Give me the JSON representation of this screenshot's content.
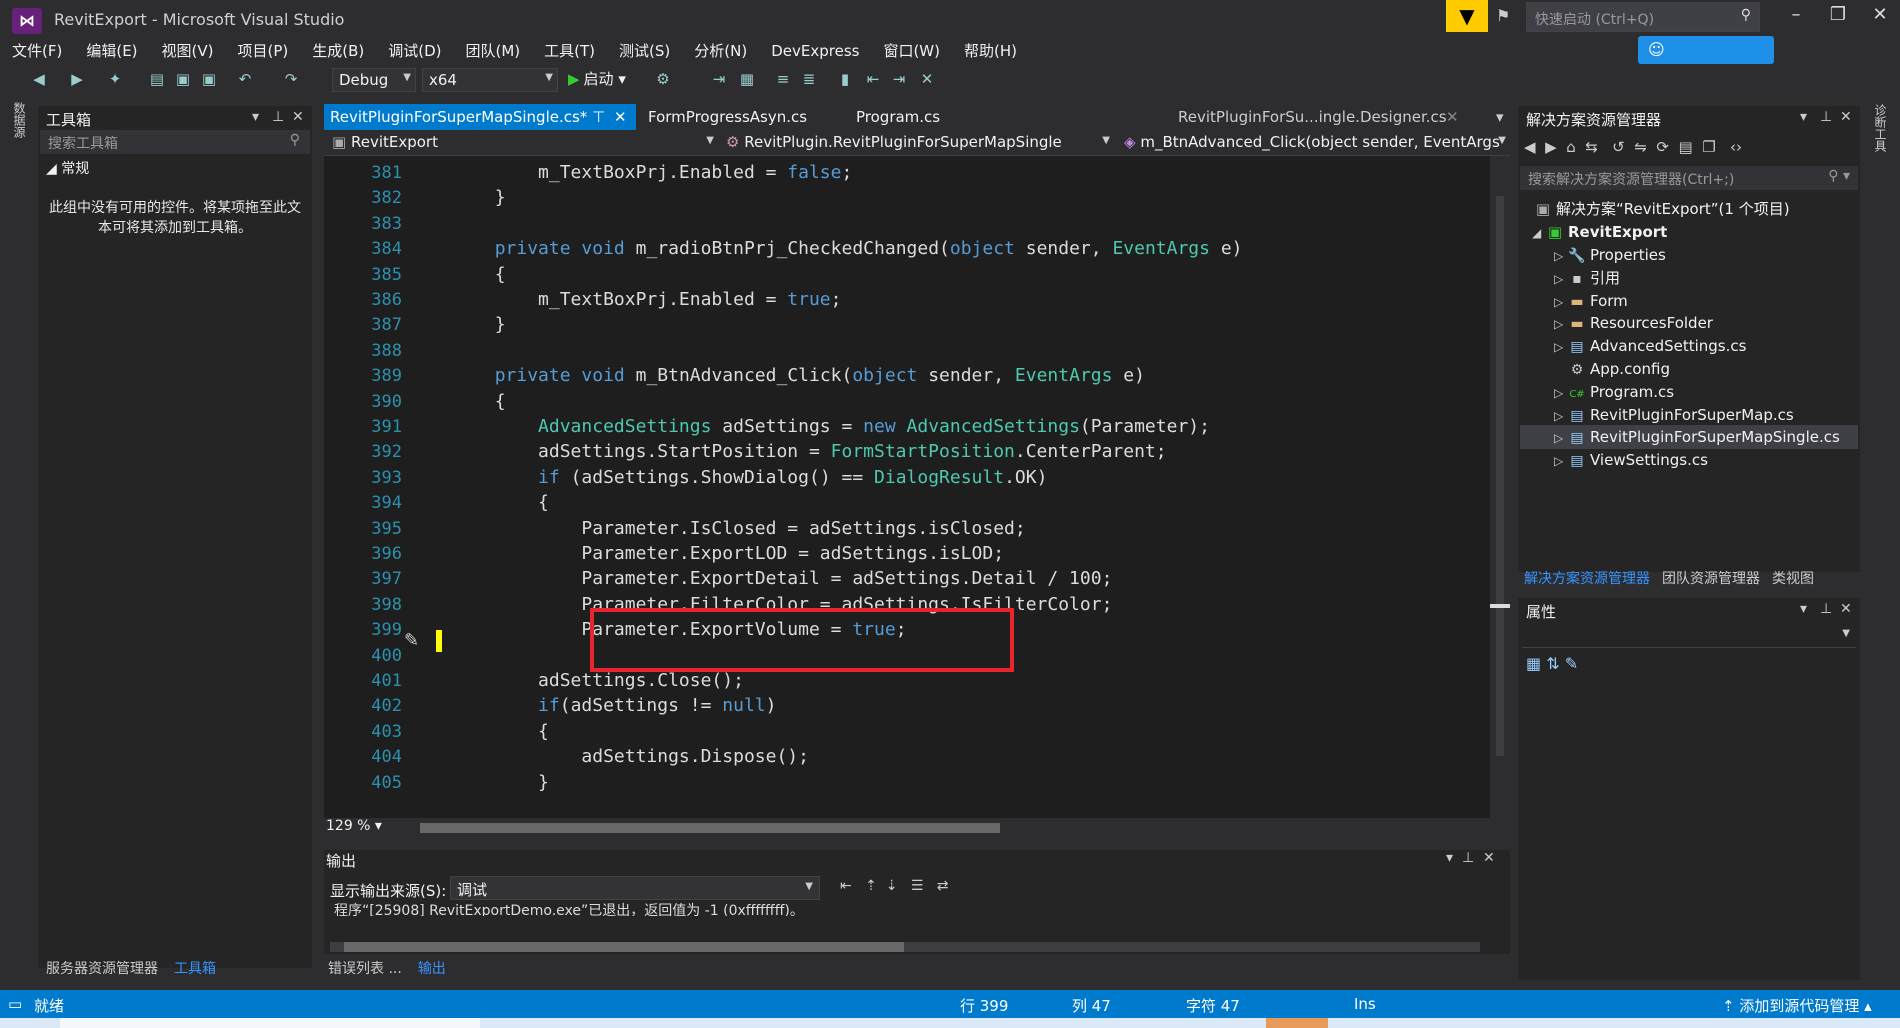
{
  "window": {
    "title": "RevitExport - Microsoft Visual Studio",
    "quick_launch_placeholder": "快速启动 (Ctrl+Q)"
  },
  "menu": [
    "文件(F)",
    "编辑(E)",
    "视图(V)",
    "项目(P)",
    "生成(B)",
    "调试(D)",
    "团队(M)",
    "工具(T)",
    "测试(S)",
    "分析(N)",
    "DevExpress",
    "窗口(W)",
    "帮助(H)"
  ],
  "toolbar": {
    "config": "Debug",
    "platform": "x64",
    "start_label": "启动"
  },
  "left_strip": {
    "tab": "数据源"
  },
  "toolbox": {
    "title": "工具箱",
    "search_placeholder": "搜索工具箱",
    "group": "◢ 常规",
    "empty_message": "此组中没有可用的控件。将某项拖至此文本可将其添加到工具箱。"
  },
  "left_bottom_tabs": [
    "服务器资源管理器",
    "工具箱"
  ],
  "doc_tabs": [
    {
      "label": "RevitPluginForSuperMapSingle.cs*",
      "active": true
    },
    {
      "label": "FormProgressAsyn.cs",
      "active": false
    },
    {
      "label": "Program.cs",
      "active": false
    },
    {
      "label": "RevitPluginForSu...ingle.Designer.cs",
      "active": false
    }
  ],
  "navbar": {
    "project": "RevitExport",
    "class": "RevitPlugin.RevitPluginForSuperMapSingle",
    "member": "m_BtnAdvanced_Click(object sender, EventArgs"
  },
  "code": {
    "line_numbers": [
      "381",
      "382",
      "383",
      "384",
      "385",
      "386",
      "387",
      "388",
      "389",
      "390",
      "391",
      "392",
      "393",
      "394",
      "395",
      "396",
      "397",
      "398",
      "399",
      "400",
      "401",
      "402",
      "403",
      "404",
      "405"
    ],
    "lines": [
      [
        {
          "t": "            m_TextBoxPrj.Enabled = "
        },
        {
          "t": "false",
          "c": "kw"
        },
        {
          "t": ";"
        }
      ],
      [
        {
          "t": "        }"
        }
      ],
      [
        {
          "t": ""
        }
      ],
      [
        {
          "t": "        "
        },
        {
          "t": "private",
          "c": "kw"
        },
        {
          "t": " "
        },
        {
          "t": "void",
          "c": "kw"
        },
        {
          "t": " m_radioBtnPrj_CheckedChanged("
        },
        {
          "t": "object",
          "c": "kw"
        },
        {
          "t": " sender, "
        },
        {
          "t": "EventArgs",
          "c": "ty"
        },
        {
          "t": " e)"
        }
      ],
      [
        {
          "t": "        {"
        }
      ],
      [
        {
          "t": "            m_TextBoxPrj.Enabled = "
        },
        {
          "t": "true",
          "c": "kw"
        },
        {
          "t": ";"
        }
      ],
      [
        {
          "t": "        }"
        }
      ],
      [
        {
          "t": ""
        }
      ],
      [
        {
          "t": "        "
        },
        {
          "t": "private",
          "c": "kw"
        },
        {
          "t": " "
        },
        {
          "t": "void",
          "c": "kw"
        },
        {
          "t": " m_BtnAdvanced_Click("
        },
        {
          "t": "object",
          "c": "kw"
        },
        {
          "t": " sender, "
        },
        {
          "t": "EventArgs",
          "c": "ty"
        },
        {
          "t": " e)"
        }
      ],
      [
        {
          "t": "        {"
        }
      ],
      [
        {
          "t": "            "
        },
        {
          "t": "AdvancedSettings",
          "c": "ty"
        },
        {
          "t": " adSettings = "
        },
        {
          "t": "new",
          "c": "kw"
        },
        {
          "t": " "
        },
        {
          "t": "AdvancedSettings",
          "c": "ty"
        },
        {
          "t": "(Parameter);"
        }
      ],
      [
        {
          "t": "            adSettings.StartPosition = "
        },
        {
          "t": "FormStartPosition",
          "c": "ty"
        },
        {
          "t": ".CenterParent;"
        }
      ],
      [
        {
          "t": "            "
        },
        {
          "t": "if",
          "c": "kw"
        },
        {
          "t": " (adSettings.ShowDialog() == "
        },
        {
          "t": "DialogResult",
          "c": "ty"
        },
        {
          "t": ".OK)"
        }
      ],
      [
        {
          "t": "            {"
        }
      ],
      [
        {
          "t": "                Parameter.IsClosed = adSettings.isClosed;"
        }
      ],
      [
        {
          "t": "                Parameter.ExportLOD = adSettings.isLOD;"
        }
      ],
      [
        {
          "t": "                Parameter.ExportDetail = adSettings.Detail / 100;"
        }
      ],
      [
        {
          "t": "                Parameter.FilterColor = adSettings.IsFilterColor;"
        }
      ],
      [
        {
          "t": "                Parameter.ExportVolume = "
        },
        {
          "t": "true",
          "c": "kw"
        },
        {
          "t": ";"
        }
      ],
      [
        {
          "t": ""
        }
      ],
      [
        {
          "t": "            adSettings.Close();"
        }
      ],
      [
        {
          "t": "            "
        },
        {
          "t": "if",
          "c": "kw"
        },
        {
          "t": "(adSettings != "
        },
        {
          "t": "null",
          "c": "kw"
        },
        {
          "t": ")"
        }
      ],
      [
        {
          "t": "            {"
        }
      ],
      [
        {
          "t": "                adSettings.Dispose();"
        }
      ],
      [
        {
          "t": "            }"
        }
      ]
    ],
    "fold_lines": [
      "384",
      "389",
      "393",
      "402"
    ]
  },
  "zoom": "129 %",
  "output": {
    "title": "输出",
    "source_label": "显示输出来源(S):",
    "source_value": "调试",
    "text": "程序“[25908] RevitExportDemo.exe”已退出，返回值为 -1 (0xffffffff)。"
  },
  "bottom_tabs": [
    "错误列表 ...",
    "输出"
  ],
  "solution_explorer": {
    "title": "解决方案资源管理器",
    "search_placeholder": "搜索解决方案资源管理器(Ctrl+;)",
    "solution": "解决方案“RevitExport”(1 个项目)",
    "project": "RevitExport",
    "items": [
      {
        "label": "Properties",
        "icon": "wrench-icon",
        "expandable": true
      },
      {
        "label": "引用",
        "icon": "references-icon",
        "expandable": true
      },
      {
        "label": "Form",
        "icon": "folder-icon",
        "expandable": true
      },
      {
        "label": "ResourcesFolder",
        "icon": "folder-icon",
        "expandable": true
      },
      {
        "label": "AdvancedSettings.cs",
        "icon": "form-icon",
        "expandable": true
      },
      {
        "label": "App.config",
        "icon": "config-icon",
        "expandable": false
      },
      {
        "label": "Program.cs",
        "icon": "csharp-icon",
        "expandable": true
      },
      {
        "label": "RevitPluginForSuperMap.cs",
        "icon": "form-icon",
        "expandable": true
      },
      {
        "label": "RevitPluginForSuperMapSingle.cs",
        "icon": "form-icon",
        "expandable": true,
        "selected": true
      },
      {
        "label": "ViewSettings.cs",
        "icon": "form-icon",
        "expandable": true
      }
    ],
    "tabs": [
      "解决方案资源管理器",
      "团队资源管理器",
      "类视图"
    ]
  },
  "properties": {
    "title": "属性"
  },
  "right_strip": {
    "tab": "诊断工具"
  },
  "status": {
    "ready": "就绪",
    "row": "行 399",
    "col": "列 47",
    "char": "字符 47",
    "mode": "Ins",
    "source_control": "添加到源代码管理"
  }
}
